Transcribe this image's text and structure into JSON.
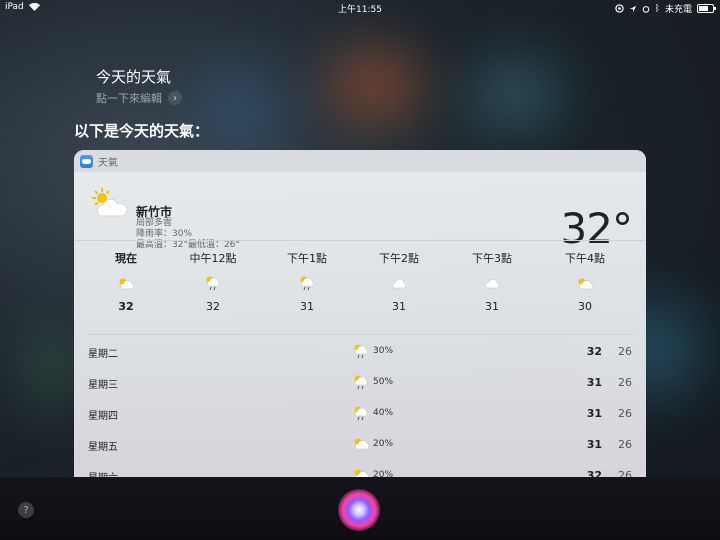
{
  "status_bar": {
    "device": "iPad",
    "time": "上午11:55",
    "charging": "未充電"
  },
  "siri": {
    "query": "今天的天氣",
    "edit_hint": "點一下來編輯",
    "response": "以下是今天的天氣："
  },
  "card": {
    "app_name": "天氣",
    "city": "新竹市",
    "condition": "局部多雲",
    "precip": "降雨率：30%",
    "high_low": "最高溫：32°最低溫：26°",
    "current_temp": "32°",
    "hourly": [
      {
        "label": "現在",
        "temp": "32",
        "icon": "partly-cloudy-icon"
      },
      {
        "label": "中午12點",
        "temp": "32",
        "icon": "cloud-rain-sun-icon"
      },
      {
        "label": "下午1點",
        "temp": "31",
        "icon": "cloud-rain-sun-icon"
      },
      {
        "label": "下午2點",
        "temp": "31",
        "icon": "cloud-icon"
      },
      {
        "label": "下午3點",
        "temp": "31",
        "icon": "cloud-icon"
      },
      {
        "label": "下午4點",
        "temp": "30",
        "icon": "partly-cloudy-icon"
      }
    ],
    "daily": [
      {
        "day": "星期二",
        "pct": "30%",
        "high": "32",
        "low": "26",
        "icon": "cloud-rain-sun-icon"
      },
      {
        "day": "星期三",
        "pct": "50%",
        "high": "31",
        "low": "26",
        "icon": "cloud-rain-sun-icon"
      },
      {
        "day": "星期四",
        "pct": "40%",
        "high": "31",
        "low": "26",
        "icon": "cloud-rain-sun-icon"
      },
      {
        "day": "星期五",
        "pct": "20%",
        "high": "31",
        "low": "26",
        "icon": "partly-cloudy-icon"
      },
      {
        "day": "星期六",
        "pct": "20%",
        "high": "32",
        "low": "26",
        "icon": "partly-cloudy-icon"
      }
    ]
  },
  "bottom": {
    "help": "?"
  }
}
